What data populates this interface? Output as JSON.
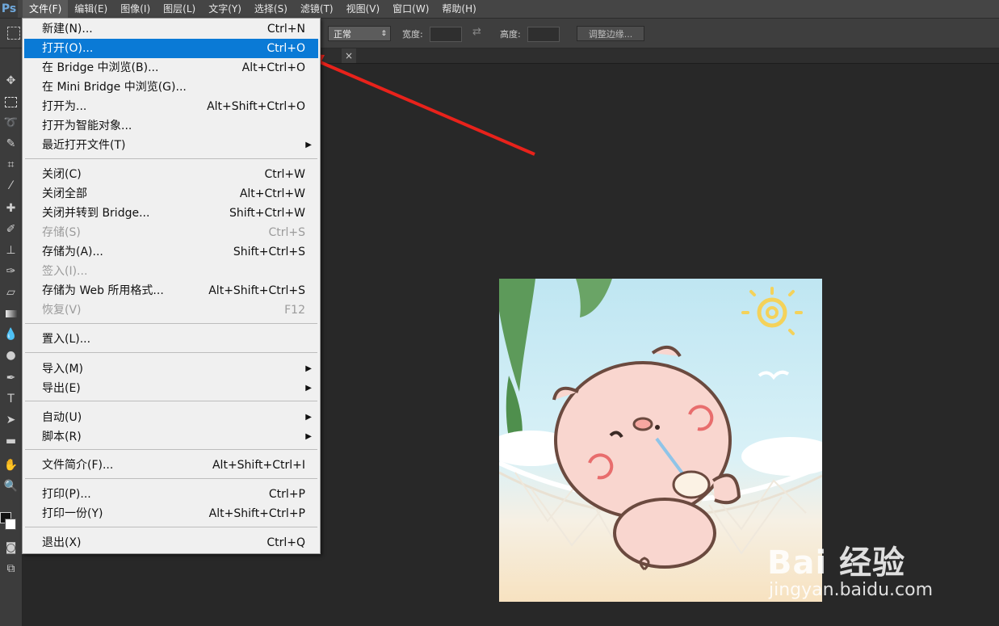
{
  "app": {
    "logo": "Ps"
  },
  "menubar": {
    "items": [
      "文件(F)",
      "编辑(E)",
      "图像(I)",
      "图层(L)",
      "文字(Y)",
      "选择(S)",
      "滤镜(T)",
      "视图(V)",
      "窗口(W)",
      "帮助(H)"
    ],
    "active_index": 0
  },
  "options": {
    "mode_value": "正常",
    "width_label": "宽度:",
    "height_label": "高度:",
    "refine_button": "调整边缘..."
  },
  "file_menu": {
    "items": [
      {
        "label": "新建(N)...",
        "shortcut": "Ctrl+N"
      },
      {
        "label": "打开(O)...",
        "shortcut": "Ctrl+O",
        "highlighted": true
      },
      {
        "label": "在 Bridge 中浏览(B)...",
        "shortcut": "Alt+Ctrl+O"
      },
      {
        "label": "在 Mini Bridge 中浏览(G)...",
        "shortcut": ""
      },
      {
        "label": "打开为...",
        "shortcut": "Alt+Shift+Ctrl+O"
      },
      {
        "label": "打开为智能对象...",
        "shortcut": ""
      },
      {
        "label": "最近打开文件(T)",
        "shortcut": "",
        "submenu": true
      },
      {
        "label": "关闭(C)",
        "shortcut": "Ctrl+W"
      },
      {
        "label": "关闭全部",
        "shortcut": "Alt+Ctrl+W"
      },
      {
        "label": "关闭并转到 Bridge...",
        "shortcut": "Shift+Ctrl+W"
      },
      {
        "label": "存储(S)",
        "shortcut": "Ctrl+S",
        "disabled": true
      },
      {
        "label": "存储为(A)...",
        "shortcut": "Shift+Ctrl+S"
      },
      {
        "label": "签入(I)...",
        "shortcut": "",
        "disabled": true
      },
      {
        "label": "存储为 Web 所用格式...",
        "shortcut": "Alt+Shift+Ctrl+S"
      },
      {
        "label": "恢复(V)",
        "shortcut": "F12",
        "disabled": true
      },
      {
        "label": "置入(L)...",
        "shortcut": ""
      },
      {
        "label": "导入(M)",
        "shortcut": "",
        "submenu": true
      },
      {
        "label": "导出(E)",
        "shortcut": "",
        "submenu": true
      },
      {
        "label": "自动(U)",
        "shortcut": "",
        "submenu": true
      },
      {
        "label": "脚本(R)",
        "shortcut": "",
        "submenu": true
      },
      {
        "label": "文件简介(F)...",
        "shortcut": "Alt+Shift+Ctrl+I"
      },
      {
        "label": "打印(P)...",
        "shortcut": "Ctrl+P"
      },
      {
        "label": "打印一份(Y)",
        "shortcut": "Alt+Shift+Ctrl+P"
      },
      {
        "label": "退出(X)",
        "shortcut": "Ctrl+Q"
      }
    ]
  },
  "watermark": {
    "logo_text": "Bai 经验",
    "url": "jingyan.baidu.com"
  },
  "colors": {
    "highlight": "#0a7ad6",
    "arrow": "#e8221b",
    "menubar": "#454545",
    "workspace": "#282828"
  }
}
